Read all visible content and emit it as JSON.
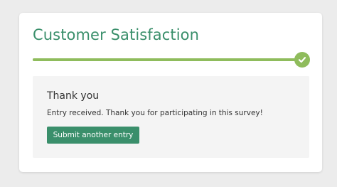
{
  "survey": {
    "title": "Customer Satisfaction",
    "progress": 1.0
  },
  "completion": {
    "heading": "Thank you",
    "message": "Entry received. Thank you for participating in this survey!",
    "submit_another_label": "Submit another entry"
  },
  "colors": {
    "accent": "#3a8f6b",
    "progress": "#8fbc5c",
    "page_background": "#ececec",
    "panel_background": "#f4f4f4"
  },
  "icons": {
    "progress_complete": "check-icon"
  }
}
